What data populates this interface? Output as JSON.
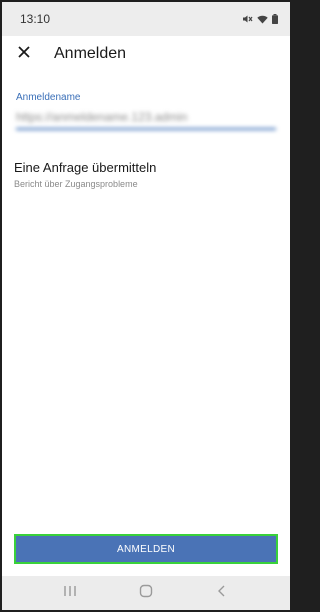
{
  "status_bar": {
    "time": "13:10",
    "icons": [
      "mute-icon",
      "wifi-icon",
      "battery-icon"
    ]
  },
  "app_bar": {
    "close_icon": "close-icon",
    "title": "Anmelden"
  },
  "username_field": {
    "label": "Anmeldename",
    "value": "https://anmeldename.123.admin"
  },
  "request_access": {
    "title": "Eine Anfrage übermitteln",
    "subtitle": "Bericht über Zugangsprobleme"
  },
  "login_button": {
    "label": "ANMELDEN"
  },
  "nav_bar": {
    "recents_icon": "recents-icon",
    "home_icon": "home-icon",
    "back_icon": "back-icon"
  },
  "colors": {
    "accent": "#3a6fb8",
    "button_bg": "#4a73b6",
    "button_border": "#39d13a"
  }
}
